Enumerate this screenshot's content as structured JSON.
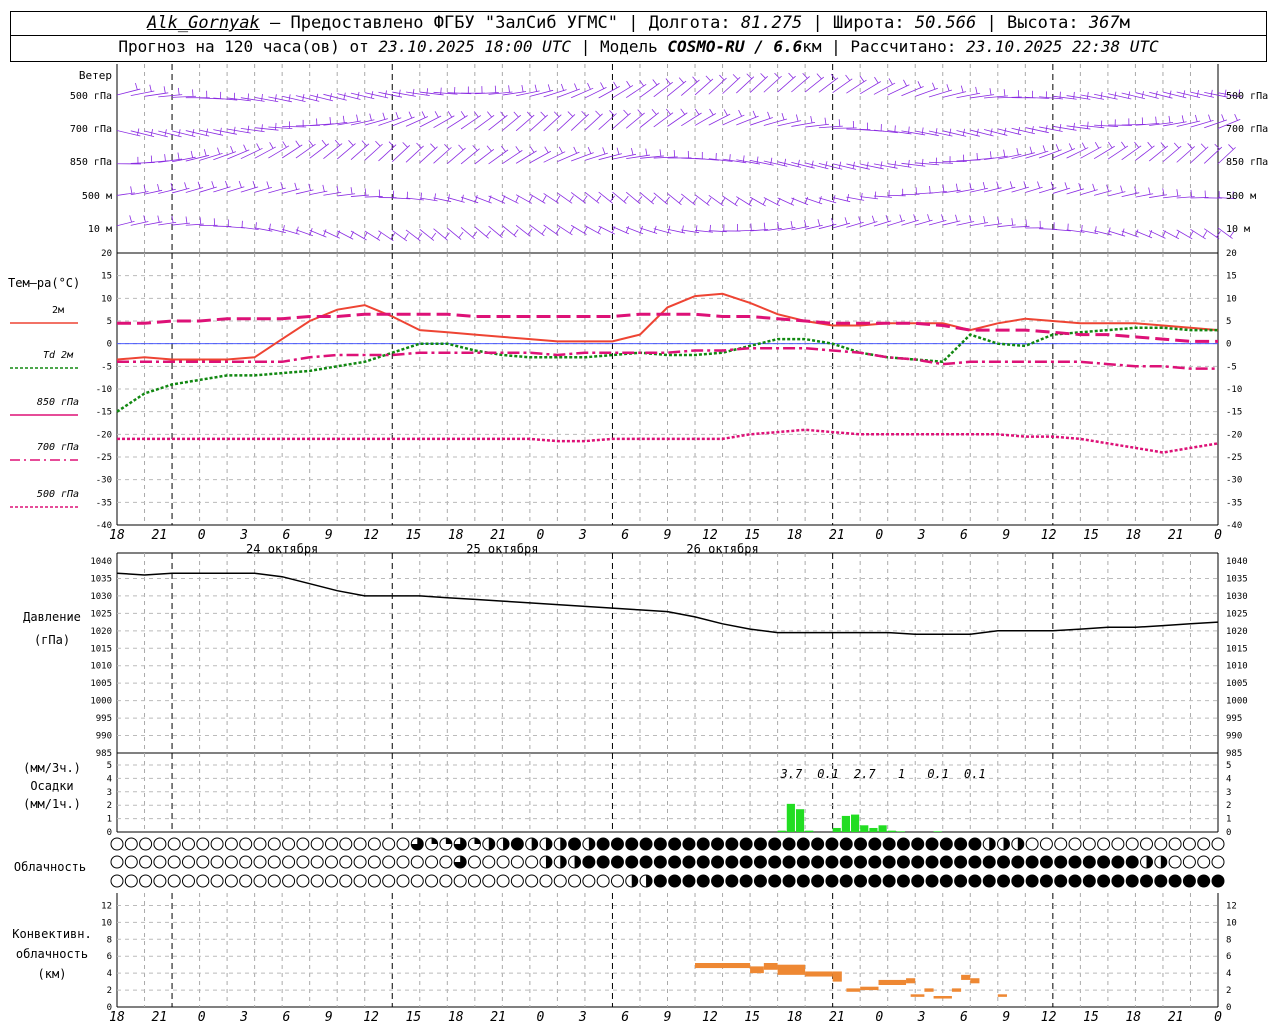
{
  "header": {
    "station": "Alk_Gornyak",
    "provider": " – Предоставлено ФГБУ \"ЗалСиб УГМС\" | Долгота: ",
    "lon": "81.275",
    "lat_label": " | Широта: ",
    "lat": "50.566",
    "alt_label": " | Высота: ",
    "alt": "367",
    "alt_unit": "м",
    "forecast_prefix": "Прогноз на 120 часа(ов) от ",
    "forecast_time": "23.10.2025 18:00 UTC",
    "model_label": " | Модель ",
    "model": "COSMO-RU / 6.6",
    "model_unit": "км",
    "calc_label": " | Рассчитано: ",
    "calc_time": "23.10.2025 22:38 UTC"
  },
  "time_axis": {
    "hour_labels": [
      "18",
      "21",
      "0",
      "3",
      "6",
      "9",
      "12",
      "15",
      "18",
      "21",
      "0",
      "3",
      "6",
      "9",
      "12",
      "15",
      "18",
      "21",
      "0",
      "3",
      "6",
      "9",
      "12",
      "15",
      "18",
      "21",
      "0"
    ],
    "day_labels": [
      "24 октября",
      "25 октября",
      "26 октября"
    ]
  },
  "wind_panel": {
    "title": "Ветер",
    "levels": [
      "500 гПа",
      "700 гПа",
      "850 гПа",
      "500 м",
      "10 м"
    ]
  },
  "temp_panel": {
    "title": "Тем–ра(°C)",
    "legend": [
      {
        "label": "2м",
        "color": "#ee4433"
      },
      {
        "label": "Td  2м",
        "color": "#118811"
      },
      {
        "label": "850 гПа",
        "color": "#dd1177"
      },
      {
        "label": "700 гПа",
        "color": "#dd1177"
      },
      {
        "label": "500 гПа",
        "color": "#dd1177"
      }
    ],
    "yticks": [
      "20",
      "15",
      "10",
      "5",
      "0",
      "-5",
      "-10",
      "-15",
      "-20",
      "-25",
      "-30",
      "-35",
      "-40"
    ]
  },
  "pressure_panel": {
    "title": "Давление",
    "unit": "(гПа)",
    "yticks": [
      "1040",
      "1035",
      "1030",
      "1025",
      "1020",
      "1015",
      "1010",
      "1005",
      "1000",
      "995",
      "990",
      "985"
    ]
  },
  "precip_panel": {
    "unit3": "(мм/3ч.)",
    "title": "Осадки",
    "unit1": "(мм/1ч.)",
    "yticks": [
      "5",
      "4",
      "3",
      "2",
      "1",
      "0"
    ],
    "totals": [
      "3.7",
      "0.1",
      "2.7",
      "1",
      "0.1",
      "0.1"
    ]
  },
  "cloud_panel": {
    "title": "Облачность"
  },
  "conv_panel": {
    "title1": "Конвективн.",
    "title2": "облачность",
    "unit": "(км)",
    "yticks": [
      "12",
      "10",
      "8",
      "6",
      "4",
      "2",
      "0"
    ]
  },
  "colors": {
    "wind": "#8a2be2",
    "t2m": "#ee4433",
    "td2m": "#118811",
    "upper": "#dd1177",
    "pressure": "#000000",
    "precip": "#22dd22",
    "convective": "#ee8833",
    "zeroline": "#3344ff"
  },
  "chart_data": [
    {
      "type": "line",
      "title": "Тем–ра(°C)",
      "x_hours": [
        0,
        3,
        6,
        9,
        12,
        15,
        18,
        21,
        24,
        27,
        30,
        33,
        36,
        39,
        42,
        45,
        48,
        51,
        54,
        57,
        60,
        63,
        66,
        69,
        72,
        75,
        78,
        81,
        84,
        87,
        90,
        93,
        96,
        99,
        102,
        105,
        108,
        111,
        114,
        117,
        120
      ],
      "ylim": [
        -40,
        20
      ],
      "series": [
        {
          "name": "2м",
          "values": [
            -3.5,
            -3,
            -3.5,
            -3.5,
            -3.5,
            -3,
            1,
            5,
            7.5,
            8.5,
            6,
            3,
            2.5,
            2,
            1.5,
            1,
            0.5,
            0.5,
            0.5,
            2,
            8,
            10.5,
            11,
            9,
            6.5,
            5,
            4,
            4,
            4.5,
            4.5,
            4.5,
            3,
            4.5,
            5.5,
            5,
            4.5,
            4.5,
            4.5,
            4,
            3.5,
            3
          ]
        },
        {
          "name": "Td  2м",
          "values": [
            -15,
            -11,
            -9,
            -8,
            -7,
            -7,
            -6.5,
            -6,
            -5,
            -4,
            -2,
            0,
            0,
            -1.5,
            -2.5,
            -3,
            -3,
            -3,
            -2.5,
            -2,
            -2.5,
            -2.5,
            -2,
            -0.5,
            1,
            1,
            0,
            -2,
            -3,
            -3.5,
            -4,
            2,
            0,
            -0.5,
            2,
            2.5,
            3,
            3.5,
            3.5,
            3,
            3
          ]
        },
        {
          "name": "850 гПа",
          "values": [
            4.5,
            4.5,
            5,
            5,
            5.5,
            5.5,
            5.5,
            6,
            6,
            6.5,
            6.5,
            6.5,
            6.5,
            6,
            6,
            6,
            6,
            6,
            6,
            6.5,
            6.5,
            6.5,
            6,
            6,
            5.5,
            5,
            4.5,
            4.5,
            4.5,
            4.5,
            4,
            3,
            3,
            3,
            2.5,
            2,
            2,
            1.5,
            1,
            0.5,
            0.5
          ]
        },
        {
          "name": "700 гПа",
          "values": [
            -4,
            -4,
            -4,
            -4,
            -4,
            -4,
            -4,
            -3,
            -2.5,
            -2.5,
            -2.5,
            -2,
            -2,
            -2,
            -2,
            -2,
            -2.5,
            -2,
            -2,
            -2,
            -2,
            -1.5,
            -1.5,
            -1,
            -1,
            -1,
            -1.5,
            -2,
            -3,
            -3.5,
            -4.5,
            -4,
            -4,
            -4,
            -4,
            -4,
            -4.5,
            -5,
            -5,
            -5.5,
            -5.5
          ]
        },
        {
          "name": "500 гПа",
          "values": [
            -21,
            -21,
            -21,
            -21,
            -21,
            -21,
            -21,
            -21,
            -21,
            -21,
            -21,
            -21,
            -21,
            -21,
            -21,
            -21,
            -21.5,
            -21.5,
            -21,
            -21,
            -21,
            -21,
            -21,
            -20,
            -19.5,
            -19,
            -19.5,
            -20,
            -20,
            -20,
            -20,
            -20,
            -20,
            -20.5,
            -20.5,
            -21,
            -22,
            -23,
            -24,
            -23,
            -22
          ]
        }
      ]
    },
    {
      "type": "line",
      "title": "Давление",
      "ylim": [
        985,
        1040
      ],
      "x_hours": [
        0,
        3,
        6,
        9,
        12,
        15,
        18,
        21,
        24,
        27,
        30,
        33,
        36,
        39,
        42,
        45,
        48,
        51,
        54,
        57,
        60,
        63,
        66,
        69,
        72,
        75,
        78,
        81,
        84,
        87,
        90,
        93,
        96,
        99,
        102,
        105,
        108,
        111,
        114,
        117,
        120
      ],
      "series": [
        {
          "name": "Давление",
          "values": [
            1036.5,
            1036,
            1036.5,
            1036.5,
            1036.5,
            1036.5,
            1035.5,
            1033.5,
            1031.5,
            1030,
            1030,
            1030,
            1029.5,
            1029,
            1028.5,
            1028,
            1027.5,
            1027,
            1026.5,
            1026,
            1025.5,
            1024,
            1022,
            1020.5,
            1019.5,
            1019.5,
            1019.5,
            1019.5,
            1019.5,
            1019,
            1019,
            1019,
            1020,
            1020,
            1020,
            1020.5,
            1021,
            1021,
            1021.5,
            1022,
            1022.5
          ]
        }
      ]
    },
    {
      "type": "bar",
      "title": "Осадки",
      "ylim": [
        0,
        5
      ],
      "x_hours": [
        72,
        73,
        74,
        75,
        76,
        77,
        78,
        79,
        80,
        81,
        82,
        83,
        84,
        85,
        86,
        87,
        88,
        89,
        90,
        91,
        92,
        93,
        94,
        95,
        96,
        97,
        98,
        99,
        100,
        101,
        102,
        103,
        104,
        105,
        106
      ],
      "values": [
        0.1,
        2.1,
        1.7,
        0.1,
        0,
        0,
        0.3,
        1.2,
        1.3,
        0.5,
        0.3,
        0.5,
        0.1,
        0.05,
        0,
        0,
        0,
        0.05,
        0,
        0,
        0,
        0,
        0,
        0,
        0,
        0,
        0,
        0,
        0,
        0,
        0,
        0,
        0,
        0,
        0
      ],
      "period_totals": [
        "3.7",
        "0.1",
        "2.7",
        "1",
        "0.1",
        "0.1"
      ]
    },
    {
      "type": "bar",
      "title": "Конвективн. облачность",
      "ylim": [
        0,
        13
      ],
      "segments_km": [
        {
          "from": 63,
          "to": 69,
          "bottom": 4.6,
          "top": 5.2
        },
        {
          "from": 69,
          "to": 70.5,
          "bottom": 4,
          "top": 4.8
        },
        {
          "from": 70.5,
          "to": 72,
          "bottom": 4.4,
          "top": 5.2
        },
        {
          "from": 72,
          "to": 75,
          "bottom": 3.8,
          "top": 5.0
        },
        {
          "from": 75,
          "to": 78,
          "bottom": 3.6,
          "top": 4.2
        },
        {
          "from": 78,
          "to": 79,
          "bottom": 3.0,
          "top": 4.2
        },
        {
          "from": 79.5,
          "to": 81,
          "bottom": 1.8,
          "top": 2.2
        },
        {
          "from": 81,
          "to": 83,
          "bottom": 2.0,
          "top": 2.4
        },
        {
          "from": 83,
          "to": 86,
          "bottom": 2.6,
          "top": 3.2
        },
        {
          "from": 86,
          "to": 87,
          "bottom": 2.8,
          "top": 3.4
        },
        {
          "from": 86.5,
          "to": 88,
          "bottom": 1.2,
          "top": 1.5
        },
        {
          "from": 88,
          "to": 89,
          "bottom": 1.8,
          "top": 2.2
        },
        {
          "from": 89,
          "to": 91,
          "bottom": 1.0,
          "top": 1.3
        },
        {
          "from": 91,
          "to": 92,
          "bottom": 1.8,
          "top": 2.2
        },
        {
          "from": 92,
          "to": 93,
          "bottom": 3.2,
          "top": 3.8
        },
        {
          "from": 93,
          "to": 94,
          "bottom": 2.8,
          "top": 3.4
        },
        {
          "from": 96,
          "to": 97,
          "bottom": 1.2,
          "top": 1.5
        }
      ]
    }
  ]
}
